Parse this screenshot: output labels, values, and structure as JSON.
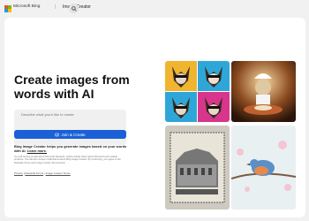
{
  "header": {
    "brand": "Microsoft Bing",
    "separator": "|",
    "product": "Image Creator"
  },
  "hero": {
    "title": "Create images from words with AI"
  },
  "prompt": {
    "placeholder": "Describe what you'd like to create"
  },
  "join_button": {
    "label": "Join & Create"
  },
  "description": {
    "text": "Bing Image Creator helps you generate images based on your words with AI.",
    "learn_more": "Learn more."
  },
  "fine_print": "You will receive emails about Microsoft Rewards, which include offers about Microsoft and rewards products. You will also receive notifications about Bing Image Creator. By continuing, you agree to the Rewards Terms and Image Creator Terms below.",
  "footer_links": [
    "Privacy",
    "Rewards Terms",
    "Image Creator Terms"
  ],
  "footer_separator": "|",
  "gallery": {
    "images": [
      {
        "subject": "chihuahua pop-art grid"
      },
      {
        "subject": "chef chihuahua at table"
      },
      {
        "subject": "engraved building postage stamp"
      },
      {
        "subject": "bird on blossom branch"
      }
    ]
  },
  "colors": {
    "page_bg": "#f1f1f1",
    "card_bg": "#ffffff",
    "accent": "#1a60d8",
    "logo": [
      "#f25022",
      "#7fba00",
      "#00a4ef",
      "#ffb900"
    ]
  }
}
